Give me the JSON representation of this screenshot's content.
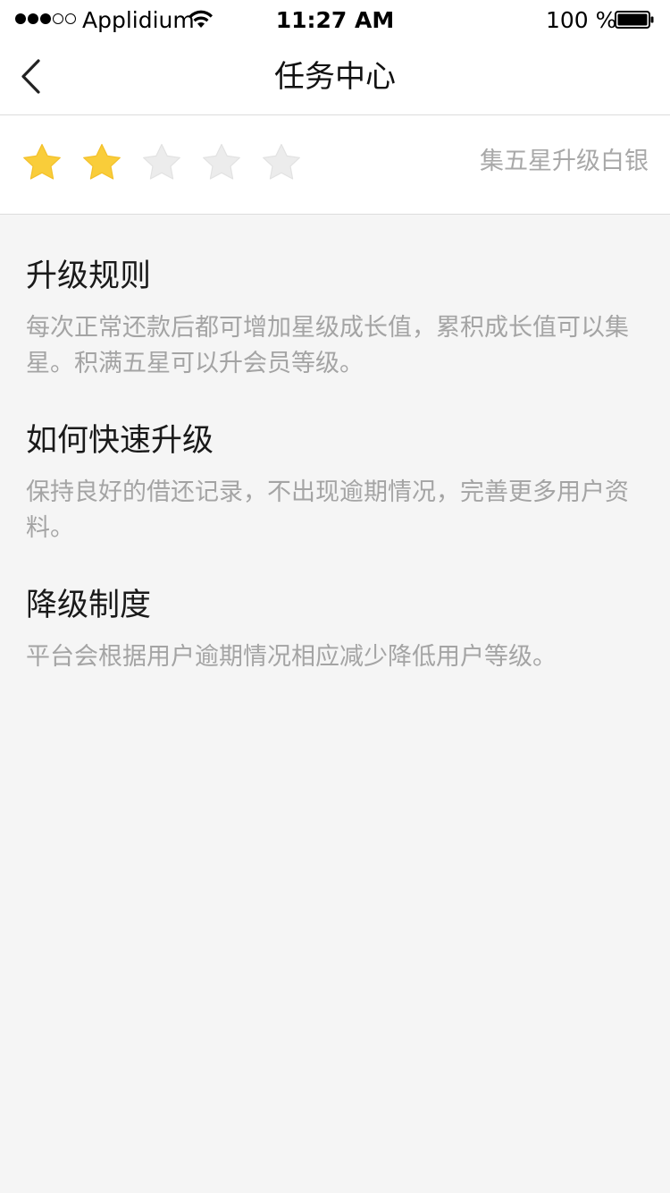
{
  "status_bar": {
    "carrier": "Applidium",
    "time": "11:27 AM",
    "battery": "100 %",
    "signal_bars_filled": 3,
    "signal_bars_total": 5,
    "icons": [
      "wifi-icon",
      "battery-icon",
      "signal-icon"
    ]
  },
  "nav": {
    "back_icon": "chevron-left-icon",
    "title": "任务中心"
  },
  "rating": {
    "stars_filled": 2,
    "stars_total": 5,
    "hint": "集五星升级白银",
    "colors": {
      "filled": "#f9cd3a",
      "empty": "#ececec"
    }
  },
  "sections": [
    {
      "title": "升级规则",
      "body": "每次正常还款后都可增加星级成长值，累积成长值可以集星。积满五星可以升会员等级。"
    },
    {
      "title": "如何快速升级",
      "body": "保持良好的借还记录，不出现逾期情况，完善更多用户资料。"
    },
    {
      "title": "降级制度",
      "body": "平台会根据用户逾期情况相应减少降低用户等级。"
    }
  ]
}
